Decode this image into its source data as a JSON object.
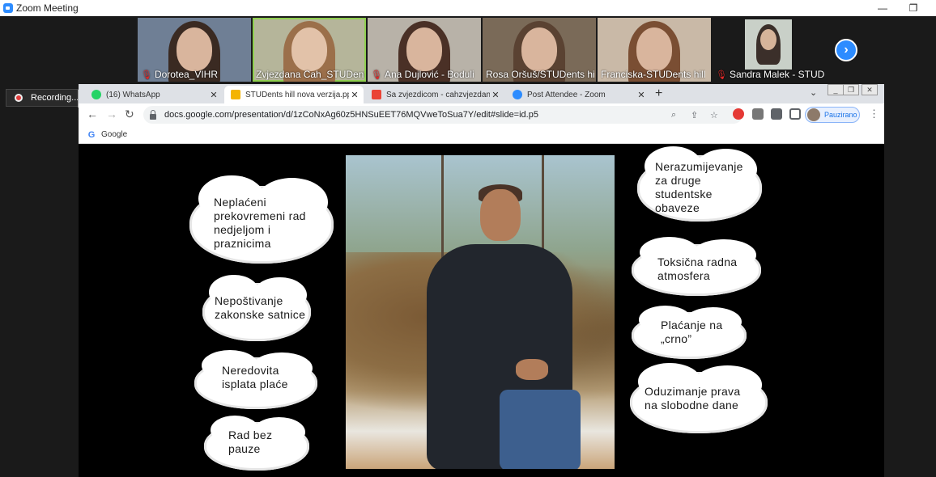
{
  "window": {
    "title": "Zoom Meeting",
    "minimize": "—",
    "restore": "❐"
  },
  "participants": [
    {
      "name": "Dorotea_VIHR",
      "muted": true
    },
    {
      "name": "Zvjezdana Cah_STUDents hill",
      "muted": false
    },
    {
      "name": "Ana Dujlović - Boduli",
      "muted": true
    },
    {
      "name": "Rosa Oršuš/STUDents hill",
      "muted": false
    },
    {
      "name": "Franciska-STUDents hill",
      "muted": false
    },
    {
      "name": "Sandra Malek - STUDents hill",
      "muted": true
    }
  ],
  "next_label": "›",
  "recording": {
    "label": "Recording..."
  },
  "browser": {
    "tabs": [
      {
        "label": "(16) WhatsApp",
        "close": "✕",
        "color": "#25d366"
      },
      {
        "label": "STUDents hill nova verzija.pptx - Google Slides",
        "close": "✕",
        "color": "#f4b400"
      },
      {
        "label": "Sa zvjezdicom - cahzvjezdana@gmail.com",
        "close": "✕",
        "color": "#ea4335"
      },
      {
        "label": "Post Attendee - Zoom",
        "close": "✕",
        "color": "#2d8cff"
      }
    ],
    "new_tab": "+",
    "tab_list": "⌄",
    "url": "docs.google.com/presentation/d/1zCoNxAg60z5HNSuEET76MQVweToSua7Y/edit#slide=id.p5",
    "profile_label": "Pauzirano",
    "bookmark": "Google"
  },
  "slide": {
    "left_clouds": [
      "Neplaćeni\nprekovremeni rad\nnedjeljom i\npraznicima",
      "Nepoštivanje\nzakonske satnice",
      "Neredovita\nisplata plaće",
      "Rad bez\npauze"
    ],
    "right_clouds": [
      "Nerazumijevanje\nza druge\nstudentske\nobaveze",
      "Toksična radna\natmosfera",
      "Plaćanje na\n„crno”",
      "Oduzimanje prava\nna slobodne dane"
    ]
  }
}
